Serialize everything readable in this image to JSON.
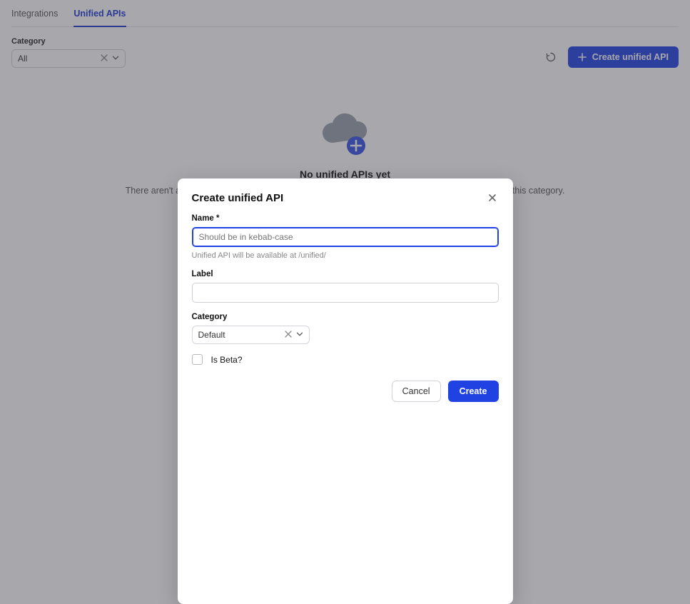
{
  "tabs": {
    "integrations": "Integrations",
    "unified_apis": "Unified APIs"
  },
  "filter": {
    "category_label": "Category",
    "category_value": "All"
  },
  "toolbar": {
    "create_label": "Create unified API"
  },
  "empty_state": {
    "heading": "No unified APIs yet",
    "body": "There aren't any unified APIs available at this time. You can start by creating a new unified API for this category."
  },
  "modal": {
    "title": "Create unified API",
    "name_label": "Name *",
    "name_placeholder": "Should be in kebab-case",
    "name_hint": "Unified API will be available at /unified/",
    "label_label": "Label",
    "category_label": "Category",
    "category_value": "Default",
    "is_beta_label": "Is Beta?",
    "cancel": "Cancel",
    "create": "Create"
  }
}
